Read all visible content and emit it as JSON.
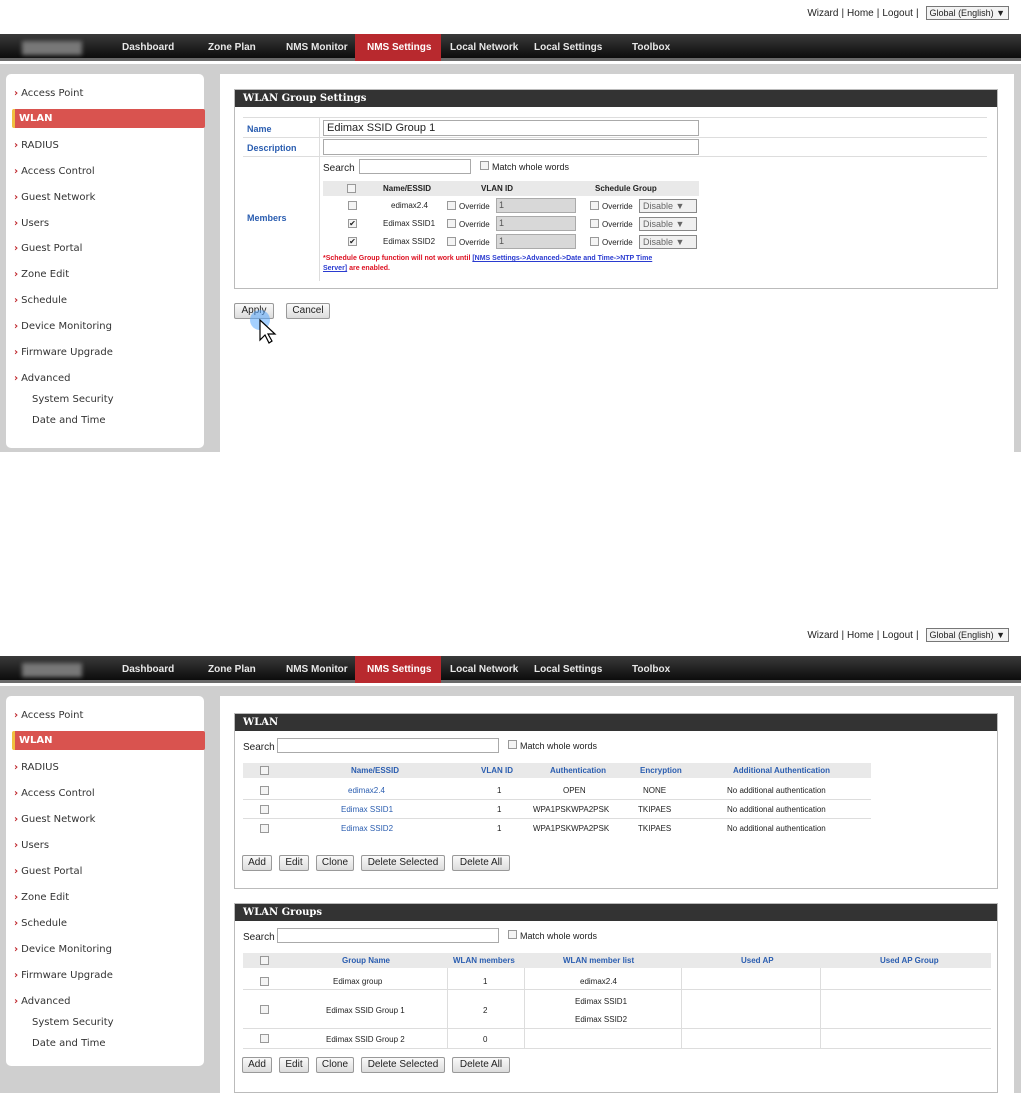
{
  "top_links": {
    "wizard": "Wizard",
    "home": "Home",
    "logout": "Logout",
    "language": "Global (English)"
  },
  "nav": [
    "Dashboard",
    "Zone Plan",
    "NMS Monitor",
    "NMS Settings",
    "Local Network",
    "Local Settings",
    "Toolbox"
  ],
  "nav_active": "NMS Settings",
  "sidebar": {
    "items": [
      "Access Point",
      "WLAN",
      "RADIUS",
      "Access Control",
      "Guest Network",
      "Users",
      "Guest Portal",
      "Zone Edit",
      "Schedule",
      "Device Monitoring",
      "Firmware Upgrade",
      "Advanced"
    ],
    "active": "WLAN",
    "sub_items": [
      "System Security",
      "Date and Time"
    ]
  },
  "screen1": {
    "panel_title": "WLAN Group Settings",
    "name_label": "Name",
    "name_value": "Edimax SSID Group 1",
    "description_label": "Description",
    "description_value": "",
    "members_label": "Members",
    "search_label": "Search",
    "match_label": "Match whole words",
    "headers": {
      "name": "Name/ESSID",
      "vlan": "VLAN ID",
      "schedule": "Schedule Group"
    },
    "override_label": "Override",
    "rows": [
      {
        "name": "edimax2.4",
        "checked": false,
        "vlan": "1",
        "schedule": "Disable"
      },
      {
        "name": "Edimax SSID1",
        "checked": true,
        "vlan": "1",
        "schedule": "Disable"
      },
      {
        "name": "Edimax SSID2",
        "checked": true,
        "vlan": "1",
        "schedule": "Disable"
      }
    ],
    "note_prefix": "*Schedule Group function will not work until ",
    "note_link_1": "[NMS Settings->Advanced->Date and Time->NTP Time",
    "note_link_2": "Server]",
    "note_suffix": " are enabled.",
    "apply": "Apply",
    "cancel": "Cancel"
  },
  "screen2": {
    "wlan_title": "WLAN",
    "search_label": "Search",
    "match_label": "Match whole words",
    "wlan_headers": [
      "Name/ESSID",
      "VLAN ID",
      "Authentication",
      "Encryption",
      "Additional Authentication"
    ],
    "wlan_rows": [
      [
        "edimax2.4",
        "1",
        "OPEN",
        "NONE",
        "No additional authentication"
      ],
      [
        "Edimax SSID1",
        "1",
        "WPA1PSKWPA2PSK",
        "TKIPAES",
        "No additional authentication"
      ],
      [
        "Edimax SSID2",
        "1",
        "WPA1PSKWPA2PSK",
        "TKIPAES",
        "No additional authentication"
      ]
    ],
    "groups_title": "WLAN Groups",
    "group_headers": [
      "Group Name",
      "WLAN members",
      "WLAN member list",
      "Used AP",
      "Used AP Group"
    ],
    "group_rows": [
      {
        "name": "Edimax group",
        "members": "1",
        "list": [
          "edimax2.4"
        ]
      },
      {
        "name": "Edimax SSID Group 1",
        "members": "2",
        "list": [
          "Edimax SSID1",
          "Edimax SSID2"
        ]
      },
      {
        "name": "Edimax SSID Group 2",
        "members": "0",
        "list": []
      }
    ],
    "buttons": [
      "Add",
      "Edit",
      "Clone",
      "Delete Selected",
      "Delete All"
    ]
  }
}
